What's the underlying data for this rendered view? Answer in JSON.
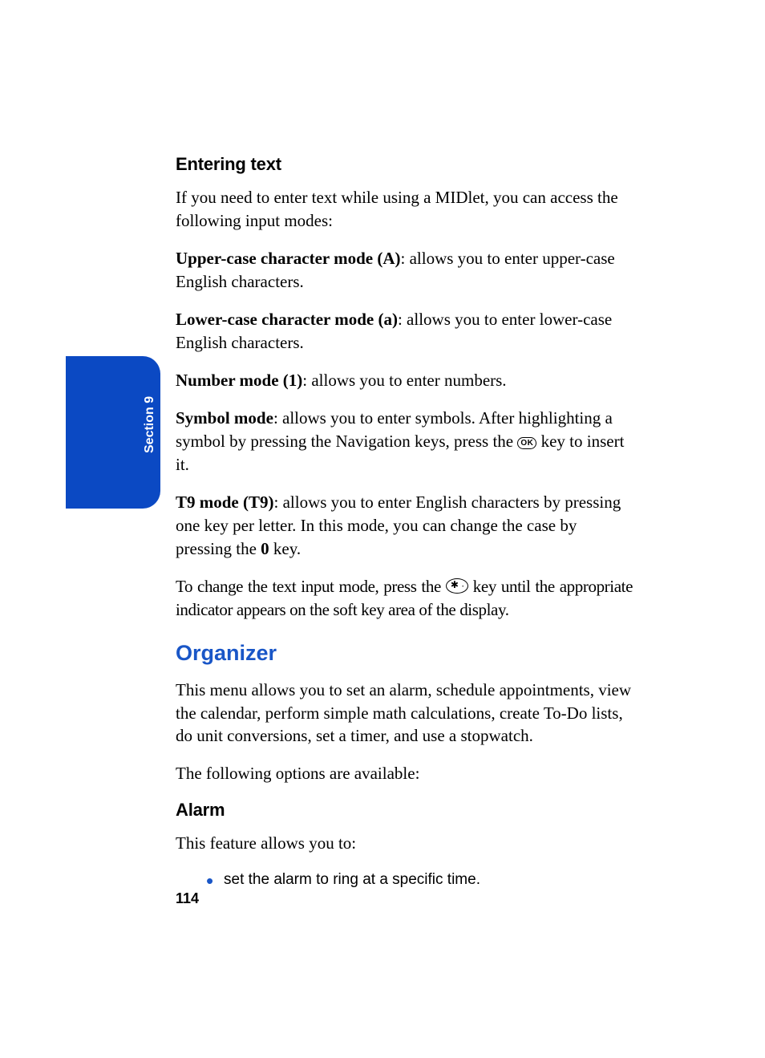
{
  "page_number": "114",
  "side_tab": "Section 9",
  "headings": {
    "entering_text": "Entering text",
    "organizer": "Organizer",
    "alarm": "Alarm"
  },
  "paragraphs": {
    "intro": "If you need to enter text while using a MIDlet, you can access the following input modes:",
    "upper_label": "Upper-case character mode (A)",
    "upper_text": ": allows you to enter upper-case English characters.",
    "lower_label": "Lower-case character mode (a)",
    "lower_text": ": allows you to enter lower-case English characters.",
    "number_label": "Number mode (1)",
    "number_text": ": allows you to enter numbers.",
    "symbol_label": "Symbol mode",
    "symbol_text_a": ": allows you to enter symbols. After highlighting a symbol by pressing the Navigation keys, press the ",
    "symbol_text_b": " key to insert it.",
    "t9_label": "T9 mode (T9)",
    "t9_text_a": ": allows you to enter English characters by pressing one key per letter. In this mode, you can change the case by pressing the ",
    "t9_zero": "0",
    "t9_text_b": " key.",
    "change_a": "To change the text input mode, press the ",
    "change_b": " key until the appropriate indicator appears on the soft key area of the display.",
    "organizer_intro": "This menu allows you to set an alarm, schedule appointments, view the calendar, perform simple math calculations, create To-Do lists, do unit conversions, set a timer, and use a stopwatch.",
    "organizer_follow": "The following options are available:",
    "alarm_intro": "This feature allows you to:"
  },
  "bullets": {
    "alarm_1": "set the alarm to ring at a specific time."
  },
  "keys": {
    "ok": "OK"
  }
}
